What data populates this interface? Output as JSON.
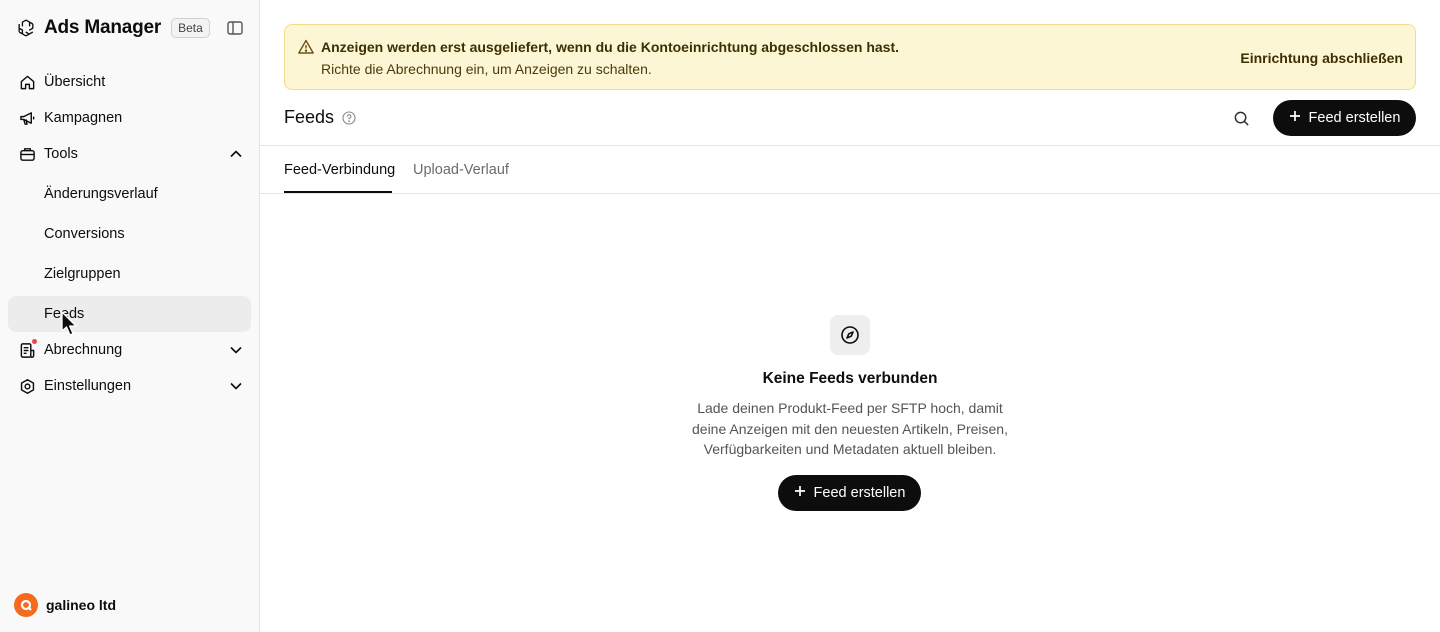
{
  "sidebar": {
    "brand": "Ads Manager",
    "badge": "Beta",
    "items": [
      {
        "label": "Übersicht"
      },
      {
        "label": "Kampagnen"
      },
      {
        "label": "Tools"
      },
      {
        "label": "Änderungsverlauf"
      },
      {
        "label": "Conversions"
      },
      {
        "label": "Zielgruppen"
      },
      {
        "label": "Feeds"
      },
      {
        "label": "Abrechnung"
      },
      {
        "label": "Einstellungen"
      }
    ],
    "account": "galineo ltd"
  },
  "banner": {
    "title": "Anzeigen werden erst ausgeliefert, wenn du die Kontoeinrichtung abgeschlossen hast.",
    "subtitle": "Richte die Abrechnung ein, um Anzeigen zu schalten.",
    "action": "Einrichtung abschließen"
  },
  "header": {
    "title": "Feeds",
    "create_label": "Feed erstellen"
  },
  "tabs": [
    {
      "label": "Feed-Verbindung"
    },
    {
      "label": "Upload-Verlauf"
    }
  ],
  "empty_state": {
    "title": "Keine Feeds verbunden",
    "line1": "Lade deinen Produkt-Feed per SFTP hoch, damit",
    "line2": "deine Anzeigen mit den neuesten Artikeln, Preisen,",
    "line3": "Verfügbarkeiten und Metadaten aktuell bleiben.",
    "button_label": "Feed erstellen"
  },
  "colors": {
    "banner_bg": "#fdf6d4",
    "primary": "#0d0d0d",
    "notification_dot": "#e5484d",
    "avatar": "#f56a1e"
  }
}
